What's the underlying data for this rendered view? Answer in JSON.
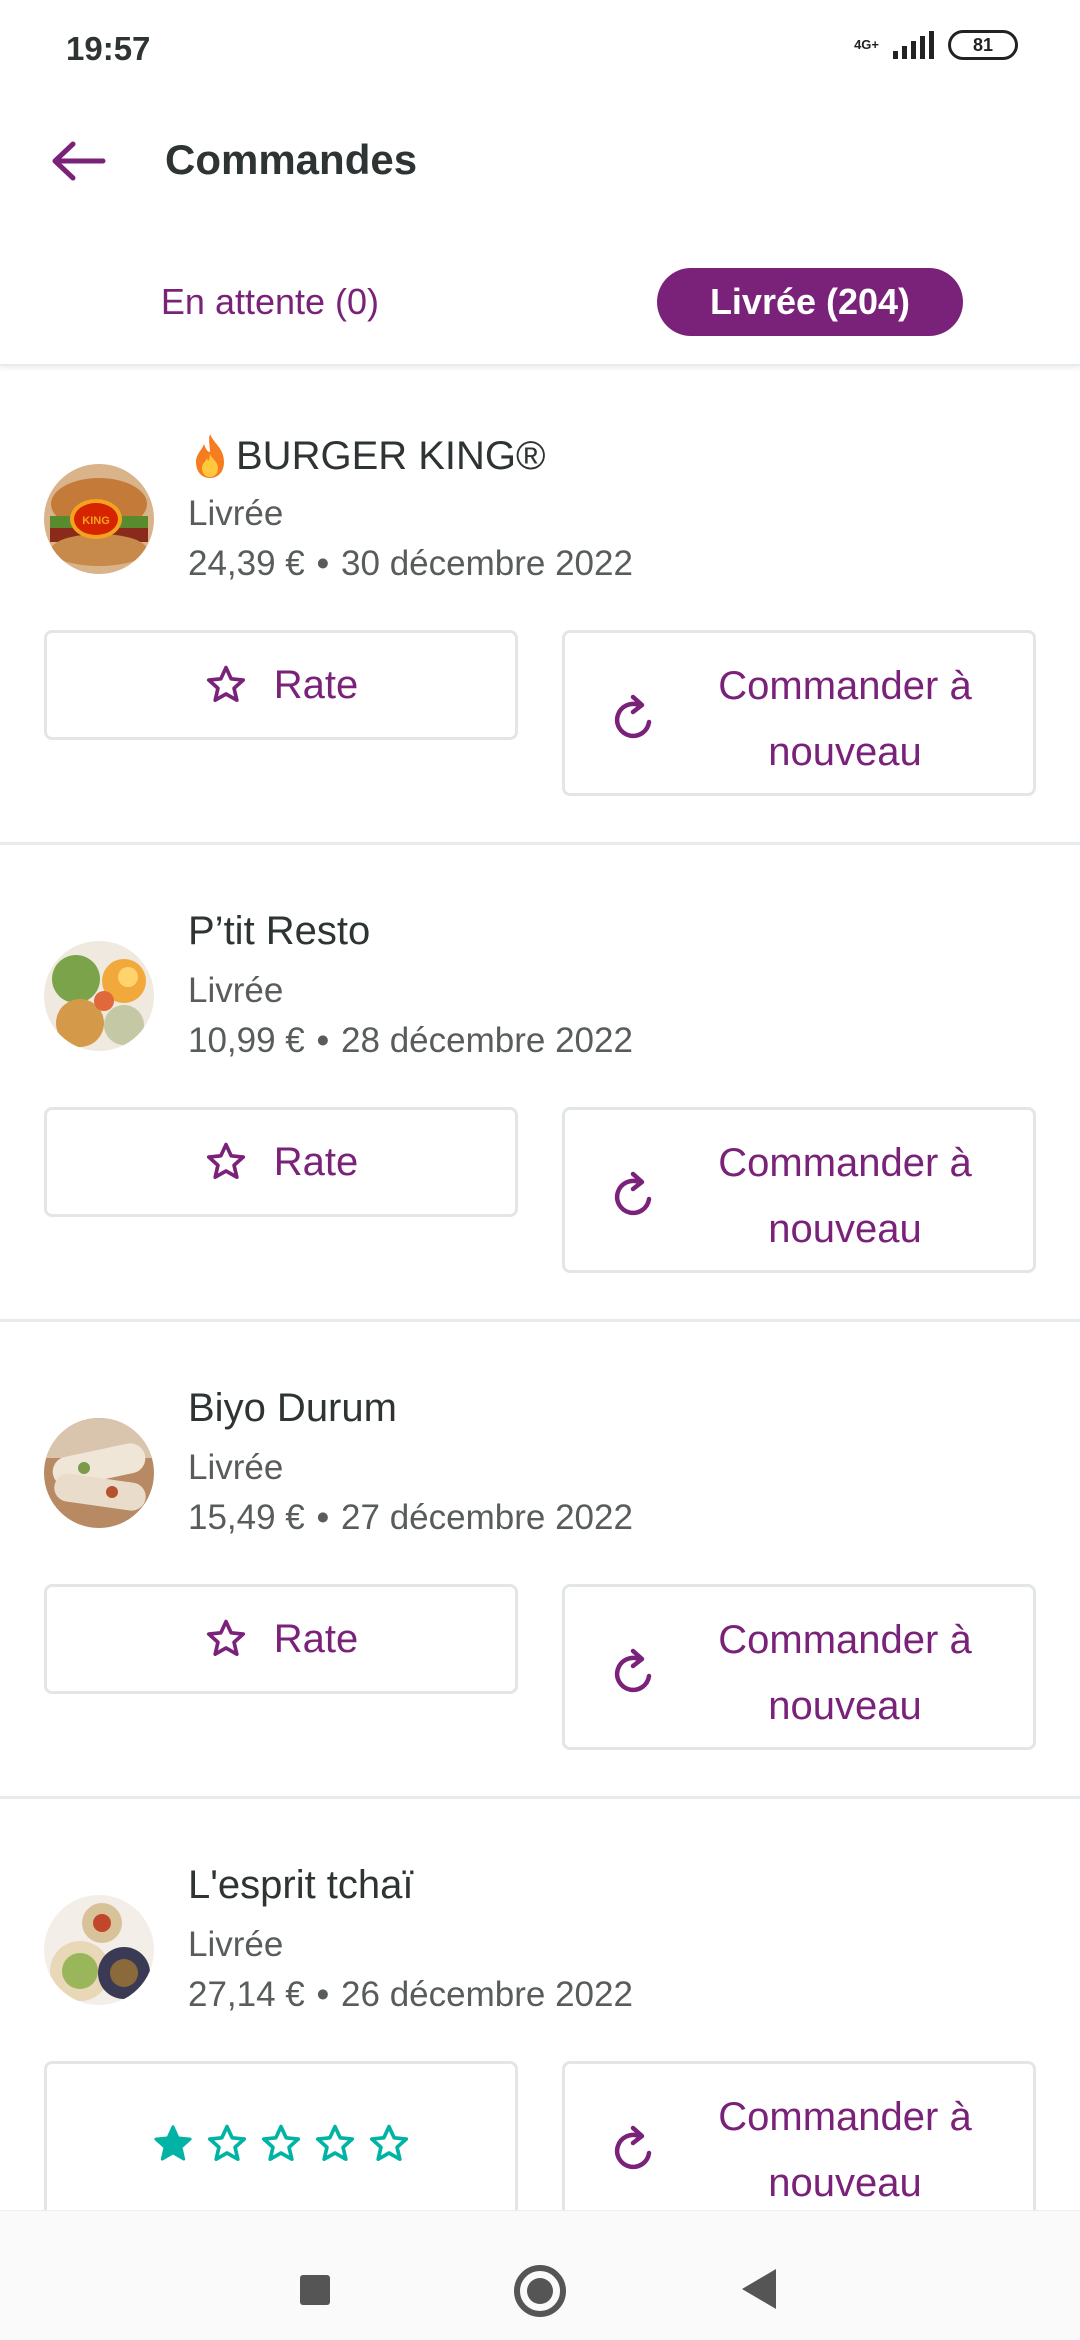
{
  "status_bar": {
    "time": "19:57",
    "network": "4G+",
    "battery": "81"
  },
  "header": {
    "title": "Commandes"
  },
  "tabs": {
    "pending": "En attente (0)",
    "delivered": "Livrée (204)"
  },
  "orders": [
    {
      "name": "BURGER KING®",
      "status": "Livrée",
      "price": "24,39 €",
      "date": "30 décembre 2022",
      "rate_label": "Rate",
      "reorder_label": "Commander à nouveau",
      "has_fire": true
    },
    {
      "name": "P’tit Resto",
      "status": "Livrée",
      "price": "10,99 €",
      "date": "28 décembre 2022",
      "rate_label": "Rate",
      "reorder_label": "Commander à nouveau"
    },
    {
      "name": "Biyo Durum",
      "status": "Livrée",
      "price": "15,49 €",
      "date": "27 décembre 2022",
      "rate_label": "Rate",
      "reorder_label": "Commander à nouveau"
    },
    {
      "name": "L'esprit tchaï",
      "status": "Livrée",
      "price": "27,14 €",
      "date": "26 décembre 2022",
      "rating_stars": 5,
      "reorder_label": "Commander à nouveau"
    }
  ],
  "colors": {
    "accent": "#7a2279",
    "star_filled": "#00b3a4",
    "text": "#2e3333",
    "muted": "#585c5c"
  },
  "icons": [
    "back-arrow-icon",
    "fire-icon",
    "star-outline-icon",
    "refresh-icon",
    "star-filled-icon",
    "star-teal-outline-icon"
  ]
}
